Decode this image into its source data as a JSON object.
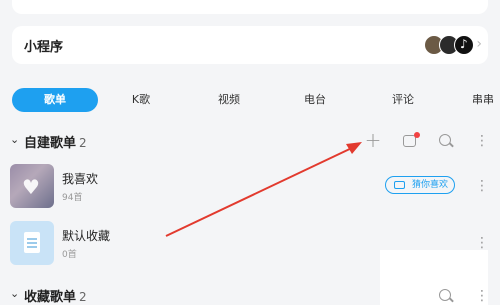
{
  "mini_programs": {
    "title": "小程序",
    "icons": [
      "mini-program-app-icon-1",
      "mini-program-app-icon-2",
      "tiktok-icon"
    ],
    "chevron": "›"
  },
  "tabs": [
    "歌单",
    "K歌",
    "视频",
    "电台",
    "评论",
    "串串"
  ],
  "created_playlists": {
    "chevron": "⌄",
    "title": "自建歌单",
    "count": "2",
    "actions": [
      "plus-icon",
      "import-icon",
      "search-icon",
      "more-icon"
    ],
    "items": [
      {
        "name": "我喜欢",
        "sub": "94首",
        "action_label": "猜你喜欢"
      },
      {
        "name": "默认收藏",
        "sub": "0首"
      }
    ]
  },
  "collected_playlists": {
    "chevron": "⌄",
    "title": "收藏歌单",
    "count": "2"
  },
  "colors": {
    "accent": "#1ea0f0",
    "annotation_arrow": "#e23a2e",
    "notification_dot": "#f24242"
  }
}
